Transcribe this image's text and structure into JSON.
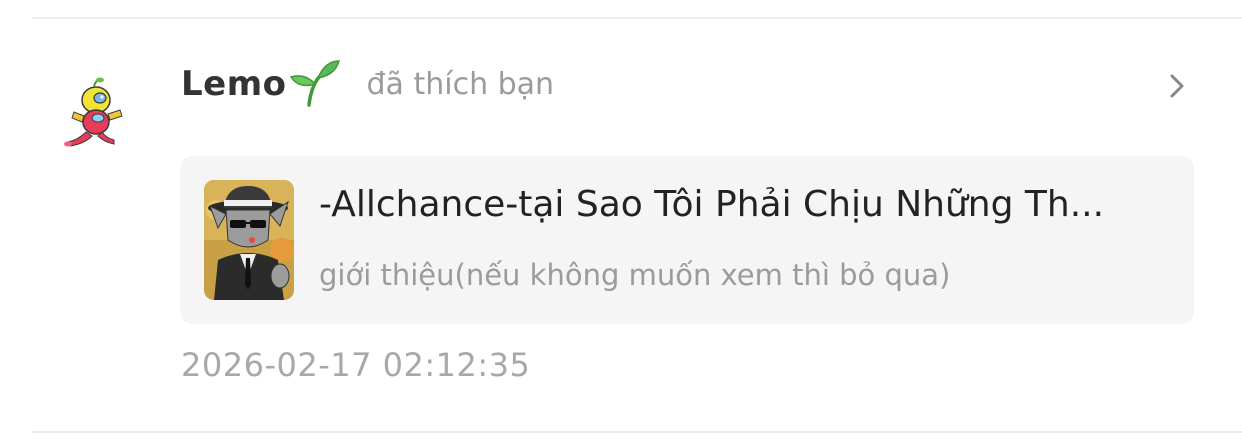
{
  "notification": {
    "username": "Lemo",
    "username_icon": "sprout-icon",
    "action": "đã thích bạn",
    "timestamp": "2026-02-17 02:12:35"
  },
  "story_card": {
    "title": "-Allchance-tại Sao Tôi Phải Chịu Những Th...",
    "subtitle": "giới thiệu(nếu không muốn xem thì bỏ qua)",
    "cover_icon": "story-cover-image"
  },
  "icons": {
    "avatar": "user-avatar",
    "chevron": "chevron-right-icon"
  },
  "colors": {
    "card_background": "#f5f5f5",
    "secondary_text": "#9b9b9b",
    "primary_text": "#333333",
    "sprout_green": "#5cb85c"
  }
}
